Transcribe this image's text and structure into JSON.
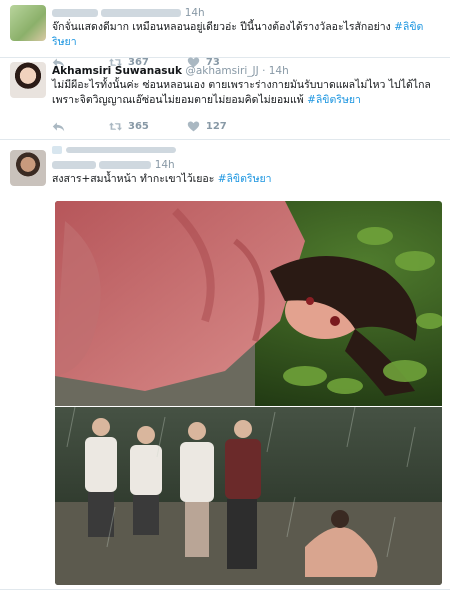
{
  "tweets": [
    {
      "time": "14h",
      "text": "จ๊กจั่นแสดงดีมาก เหมือนหลอนอยู่เดียวอ่ะ ปีนี้นางต้องได้รางวัลอะไรสักอย่าง ",
      "hashtag": "#ลิขิตริษยา",
      "retweets": "367",
      "likes": "73"
    },
    {
      "name": "Akhamsiri Suwanasuk",
      "handle": "@akhamsiri_JJ",
      "time": "· 14h",
      "text_line1": "ไม่มีผีอะไรทั้งนั้นค่ะ ซ่อนหลอนเอง ตายเพราะร่างกายมันรับบาดแผลไม่ไหว ไปได้ไกล",
      "text_line2": "เพราะจิตวิญญาณเอ๊ซ่อนไม่ยอมตายไม่ยอมคิดไม่ยอมแพ้ ",
      "hashtag": "#ลิขิตริษยา",
      "retweets": "365",
      "likes": "127"
    },
    {
      "time": "14h",
      "text": "สงสาร+สมน้ำหน้า ทำกะเขาไว้เยอะ ",
      "hashtag": "#ลิขิตริษยา"
    }
  ],
  "icons": {
    "reply": "reply-icon",
    "retweet": "retweet-icon",
    "like": "heart-icon"
  },
  "colors": {
    "link": "#1b95e0",
    "muted": "#8899a6"
  }
}
